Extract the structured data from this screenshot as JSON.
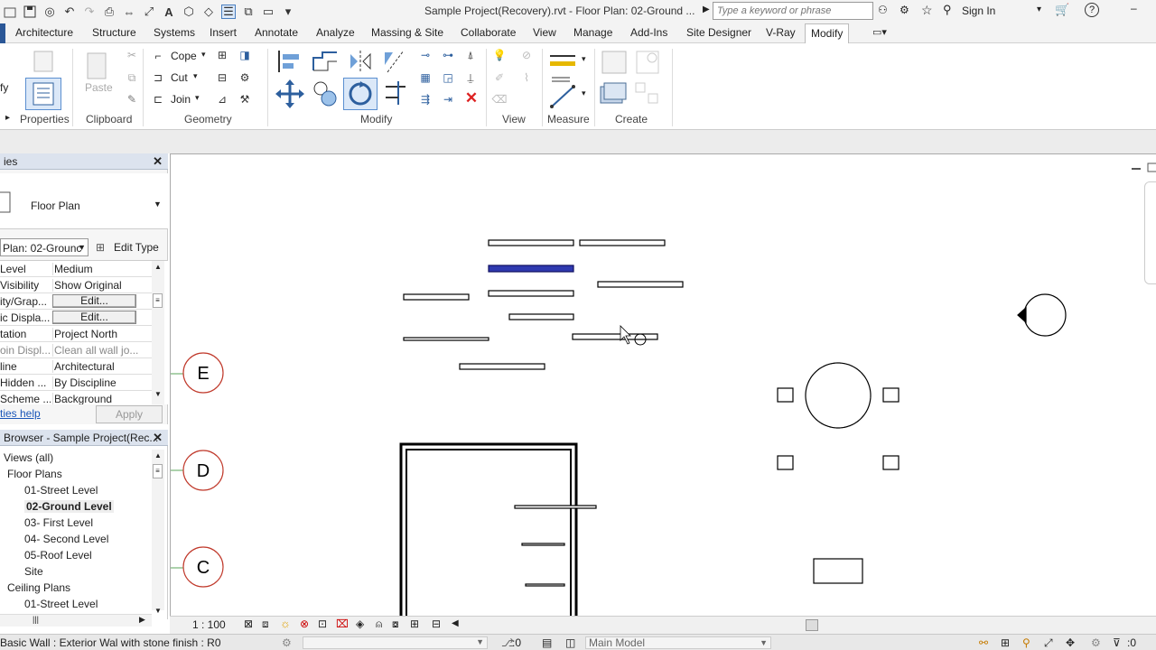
{
  "qat": {
    "title": "Sample Project(Recovery).rvt - Floor Plan: 02-Ground ...",
    "search_placeholder": "Type a keyword or phrase",
    "sign_in": "Sign In",
    "help_glyph": "?"
  },
  "tabs": [
    "Architecture",
    "Structure",
    "Systems",
    "Insert",
    "Annotate",
    "Analyze",
    "Massing & Site",
    "Collaborate",
    "View",
    "Manage",
    "Add-Ins",
    "Site Designer",
    "V-Ray",
    "Modify"
  ],
  "active_tab": "Modify",
  "ribbon": {
    "modify_partial": "fy",
    "properties": "Properties",
    "paste": "Paste",
    "clipboard": "Clipboard",
    "cope": "Cope",
    "cut": "Cut",
    "join": "Join",
    "geometry": "Geometry",
    "modify": "Modify",
    "view": "View",
    "measure": "Measure",
    "create": "Create"
  },
  "properties": {
    "header": "ies",
    "type": "Floor Plan",
    "instance": "Plan: 02-Grounc",
    "edit_type": "Edit Type",
    "rows": [
      {
        "key": "Level",
        "value": "Medium"
      },
      {
        "key": "Visibility",
        "value": "Show Original"
      },
      {
        "key": "ity/Grap...",
        "value": "Edit...",
        "button": true
      },
      {
        "key": "ic Displa...",
        "value": "Edit...",
        "button": true
      },
      {
        "key": "tation",
        "value": "Project North"
      },
      {
        "key": "oin Displ...",
        "value": "Clean all wall jo...",
        "grey": true
      },
      {
        "key": "line",
        "value": "Architectural"
      },
      {
        "key": "Hidden ...",
        "value": "By Discipline"
      },
      {
        "key": "Scheme ...",
        "value": "Background"
      }
    ],
    "help": "ties help",
    "apply": "Apply"
  },
  "browser": {
    "header": "Browser - Sample Project(Rec...",
    "items": [
      {
        "label": "Views (all)",
        "bold": false
      },
      {
        "label": "Floor Plans",
        "bold": false
      },
      {
        "label": "01-Street Level",
        "bold": false
      },
      {
        "label": "02-Ground Level",
        "bold": true
      },
      {
        "label": "03- First Level",
        "bold": false
      },
      {
        "label": "04- Second Level",
        "bold": false
      },
      {
        "label": "05-Roof Level",
        "bold": false
      },
      {
        "label": "Site",
        "bold": false
      },
      {
        "label": "Ceiling Plans",
        "bold": false
      },
      {
        "label": "01-Street Level",
        "bold": false
      }
    ]
  },
  "grids": [
    "E",
    "D",
    "C"
  ],
  "view_control": {
    "scale": "1 : 100"
  },
  "status": {
    "text": "Basic Wall : Exterior Wal with stone finish : R0",
    "worksets": ":0",
    "model": "Main Model"
  }
}
